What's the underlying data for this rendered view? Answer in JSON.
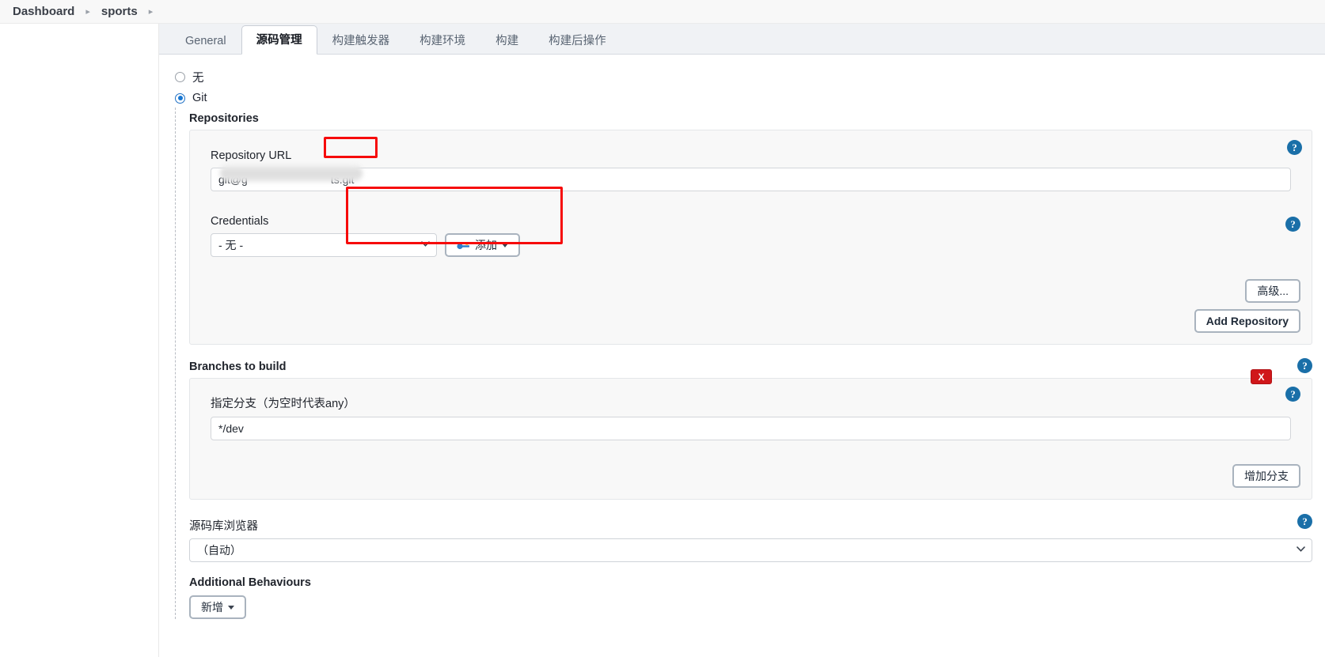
{
  "breadcrumb": {
    "items": [
      {
        "label": "Dashboard"
      },
      {
        "label": "sports"
      }
    ],
    "separator": "▸"
  },
  "tabs": [
    {
      "label": "General",
      "active": false
    },
    {
      "label": "源码管理",
      "active": true
    },
    {
      "label": "构建触发器",
      "active": false
    },
    {
      "label": "构建环境",
      "active": false
    },
    {
      "label": "构建",
      "active": false
    },
    {
      "label": "构建后操作",
      "active": false
    }
  ],
  "scm": {
    "options": [
      {
        "label": "无",
        "checked": false
      },
      {
        "label": "Git",
        "checked": true
      }
    ]
  },
  "repositories": {
    "section_label": "Repositories",
    "url_label": "Repository URL",
    "url_value": "git@g                           ts.git",
    "url_prefix": "git@g",
    "url_suffix": "ts.git",
    "credentials_label": "Credentials",
    "credentials_value": "- 无 -",
    "add_credentials_label": "添加",
    "advanced_label": "高级...",
    "add_repository_label": "Add Repository"
  },
  "branches": {
    "section_label": "Branches to build",
    "field_label": "指定分支（为空时代表any）",
    "value": "*/dev",
    "add_branch_label": "增加分支",
    "delete_label": "X"
  },
  "browser": {
    "label": "源码库浏览器",
    "value": "（自动）"
  },
  "additional": {
    "label": "Additional Behaviours",
    "add_label": "新增"
  },
  "icons": {
    "help": "?",
    "chevron_down": "⌄"
  },
  "colors": {
    "accent": "#1877d2",
    "help_blue": "#1a6fa8",
    "danger_red": "#d0171a",
    "highlight_red": "#f60b0b"
  }
}
